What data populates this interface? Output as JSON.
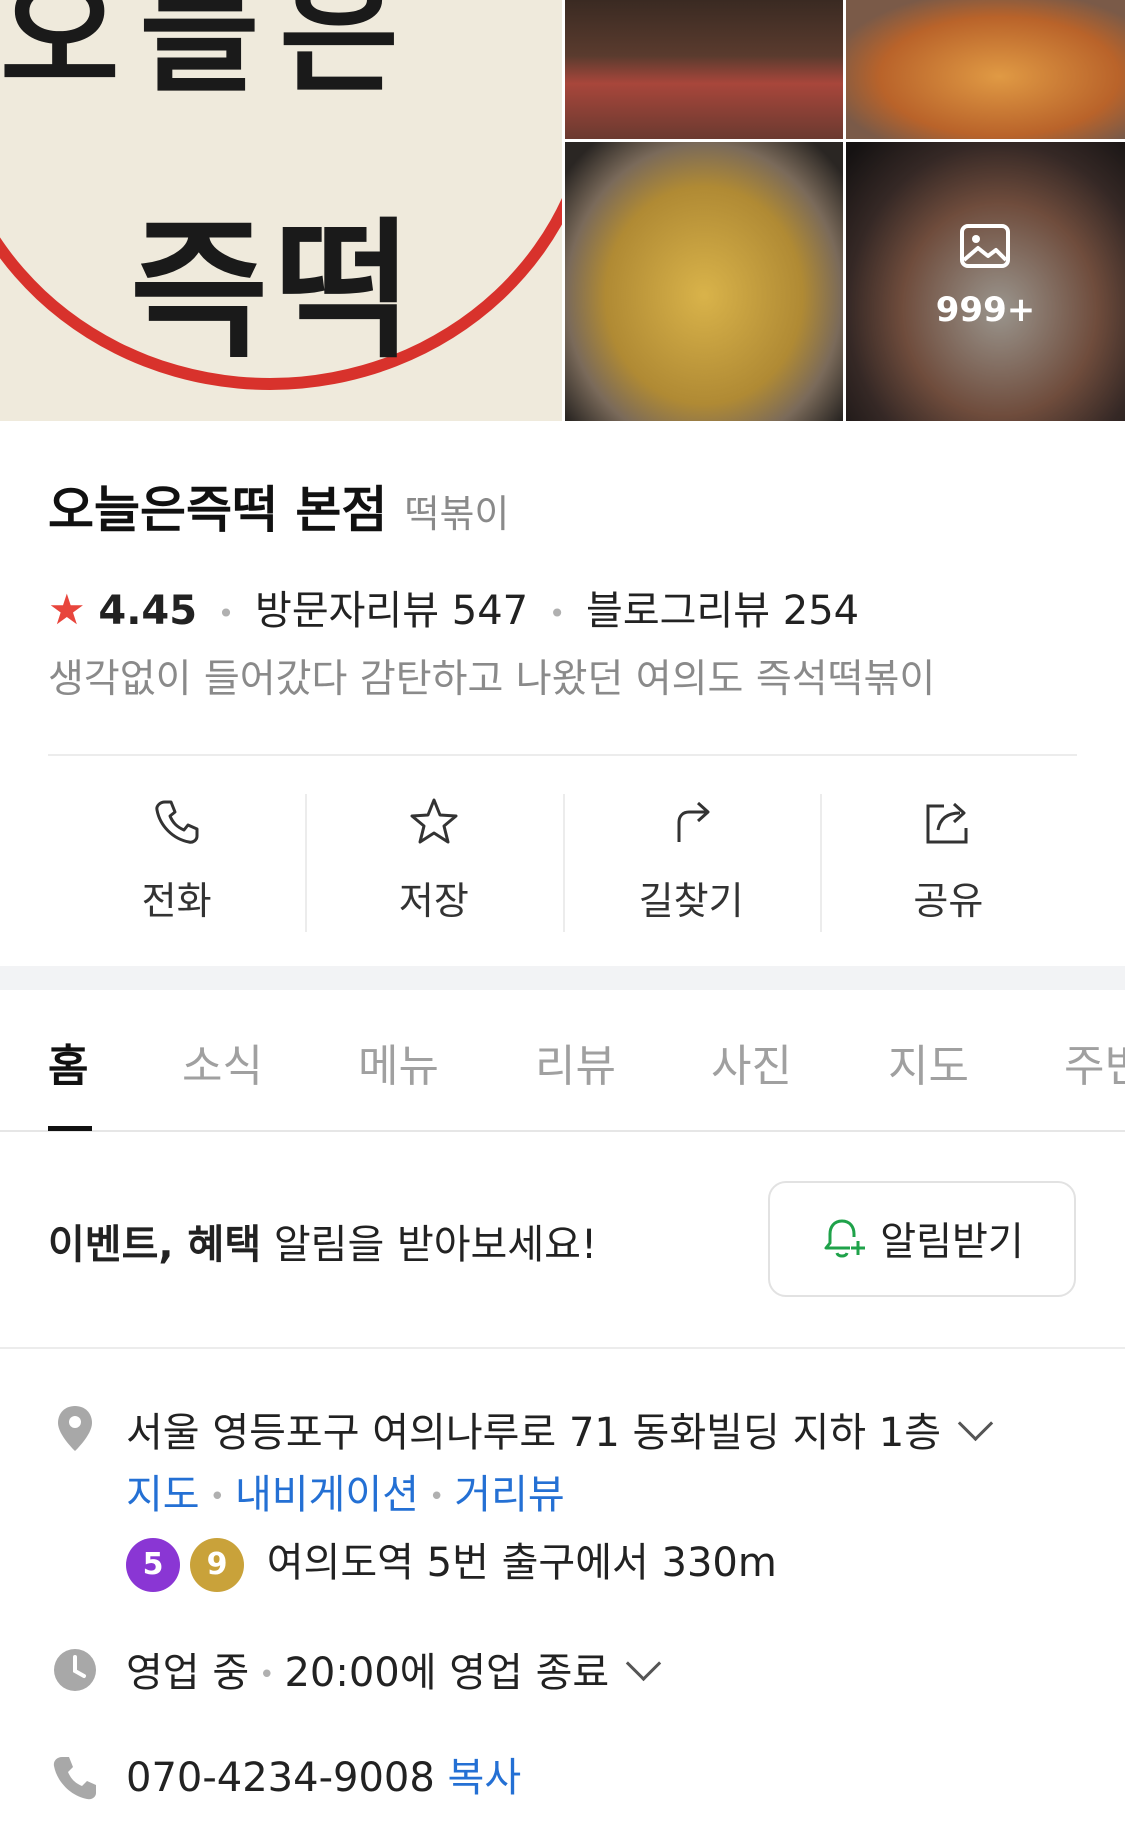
{
  "gallery": {
    "main_sign_text": "즉떡",
    "main_sign_top_text": "오늘은",
    "photo_count": "999+"
  },
  "place": {
    "name": "오늘은즉떡 본점",
    "category": "떡볶이",
    "rating": "4.45",
    "visitor_reviews": "방문자리뷰 547",
    "blog_reviews": "블로그리뷰 254",
    "description": "생각없이 들어갔다 감탄하고 나왔던 여의도 즉석떡볶이"
  },
  "actions": {
    "call": "전화",
    "save": "저장",
    "directions": "길찾기",
    "share": "공유"
  },
  "tabs": [
    "홈",
    "소식",
    "메뉴",
    "리뷰",
    "사진",
    "지도",
    "주변"
  ],
  "notice": {
    "bold_part": "이벤트, 혜택",
    "rest": " 알림을 받아보세요!",
    "button": "알림받기"
  },
  "info": {
    "address": "서울 영등포구 여의나루로 71 동화빌딩 지하 1층",
    "links": [
      "지도",
      "내비게이션",
      "거리뷰"
    ],
    "subway_lines": [
      {
        "line": "5",
        "color": "#8a36d4"
      },
      {
        "line": "9",
        "color": "#c9a23a"
      }
    ],
    "subway_text": "여의도역 5번 출구에서 330m",
    "hours_status": "영업 중",
    "hours_close": "20:00에 영업 종료",
    "phone": "070-4234-9008",
    "copy": "복사"
  },
  "colors": {
    "accent_blue": "#2470d4",
    "star_red": "#e8453c",
    "bell_green": "#1fa24a"
  }
}
